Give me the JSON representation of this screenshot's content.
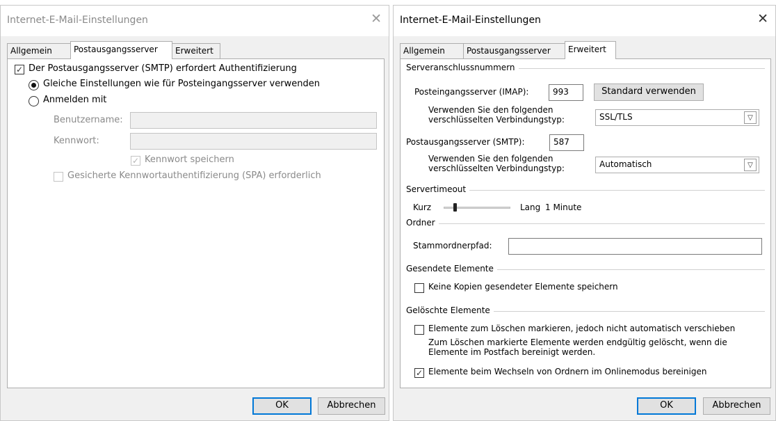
{
  "left_dialog": {
    "title": "Internet-E-Mail-Einstellungen",
    "tabs": [
      "Allgemein",
      "Postausgangsserver",
      "Erweitert"
    ],
    "active_tab": "Postausgangsserver",
    "smtp_auth_label": "Der Postausgangsserver (SMTP) erfordert Authentifizierung",
    "smtp_auth_checked": true,
    "same_settings_label": "Gleiche Einstellungen wie für Posteingangsserver verwenden",
    "same_settings_selected": true,
    "login_with_label": "Anmelden mit",
    "username_label": "Benutzername:",
    "username_value": "",
    "password_label": "Kennwort:",
    "password_value": "",
    "save_password_label": "Kennwort speichern",
    "save_password_checked": true,
    "spa_label": "Gesicherte Kennwortauthentifizierung (SPA) erforderlich",
    "spa_checked": false,
    "ok_label": "OK",
    "cancel_label": "Abbrechen"
  },
  "right_dialog": {
    "title": "Internet-E-Mail-Einstellungen",
    "tabs": [
      "Allgemein",
      "Postausgangsserver",
      "Erweitert"
    ],
    "active_tab": "Erweitert",
    "server_ports": {
      "group_label": "Serveranschlussnummern",
      "incoming_label": "Posteingangsserver (IMAP):",
      "incoming_port": "993",
      "default_button": "Standard verwenden",
      "incoming_enc_label": "Verwenden Sie den folgenden verschlüsselten Verbindungstyp:",
      "incoming_enc_value": "SSL/TLS",
      "outgoing_label": "Postausgangsserver (SMTP):",
      "outgoing_port": "587",
      "outgoing_enc_label": "Verwenden Sie den folgenden verschlüsselten Verbindungstyp:",
      "outgoing_enc_value": "Automatisch"
    },
    "timeout": {
      "group_label": "Servertimeout",
      "short_label": "Kurz",
      "long_label": "Lang",
      "value": "1 Minute"
    },
    "folders": {
      "group_label": "Ordner",
      "root_path_label": "Stammordnerpfad:",
      "root_path_value": ""
    },
    "sent_items": {
      "group_label": "Gesendete Elemente",
      "no_copies_label": "Keine Kopien gesendeter Elemente speichern",
      "no_copies_checked": false
    },
    "deleted_items": {
      "group_label": "Gelöschte Elemente",
      "mark_label": "Elemente zum Löschen markieren, jedoch nicht automatisch verschieben",
      "mark_checked": false,
      "info_text": "Zum Löschen markierte Elemente werden endgültig gelöscht, wenn die Elemente im Postfach bereinigt werden.",
      "purge_label": "Elemente beim Wechseln von Ordnern im Onlinemodus bereinigen",
      "purge_checked": true
    },
    "ok_label": "OK",
    "cancel_label": "Abbrechen"
  }
}
